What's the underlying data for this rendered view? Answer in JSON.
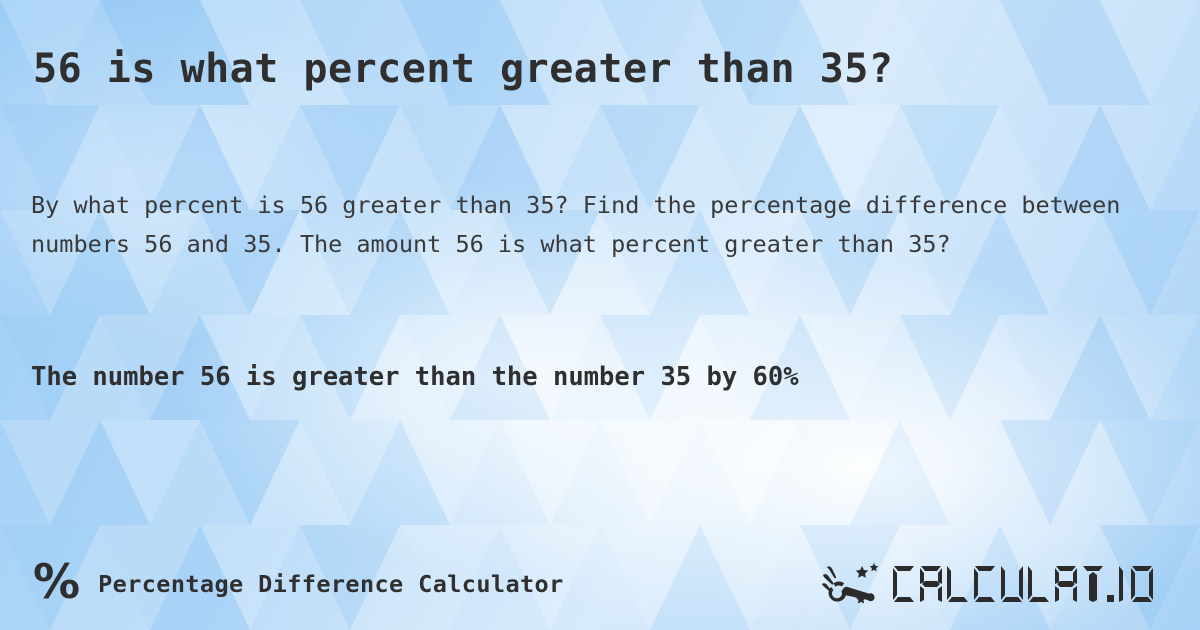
{
  "page": {
    "title": "56 is what percent greater than 35?",
    "description": "By what percent is 56 greater than 35? Find the percentage difference between numbers 56 and 35. The amount 56 is what percent greater than 35?",
    "result": "The number 56 is greater than the number 35 by 60%"
  },
  "values": {
    "number_a": "56",
    "number_b": "35",
    "percent_difference": "60%"
  },
  "footer": {
    "percent_icon": "%",
    "brand_label": "Percentage Difference Calculator",
    "logo_text": "CALCULAT.IO",
    "logo_mark_name": "hand-holding-magic-wand-icon"
  },
  "colors": {
    "background_light": "#cfe6fb",
    "background_blue": "#9ecdf6",
    "text_dark": "#2f2f2f",
    "text_body": "#3a3a3a",
    "logo_dark": "#2b2b2b"
  }
}
